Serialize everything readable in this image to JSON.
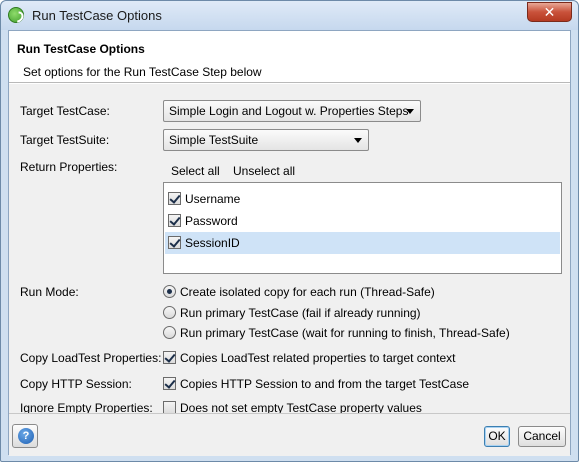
{
  "window": {
    "title": "Run TestCase Options",
    "close_glyph": "✕",
    "app_icon": "soapui-icon"
  },
  "header": {
    "title": "Run TestCase Options",
    "subtitle": "Set options for the Run TestCase Step below"
  },
  "form": {
    "target_testcase": {
      "label": "Target TestCase:",
      "value": "Simple Login and Logout w. Properties Steps"
    },
    "target_testsuite": {
      "label": "Target TestSuite:",
      "value": "Simple TestSuite"
    },
    "return_properties": {
      "label": "Return Properties:",
      "select_all": "Select all",
      "unselect_all": "Unselect all",
      "items": [
        {
          "label": "Username",
          "checked": true,
          "selected": false
        },
        {
          "label": "Password",
          "checked": true,
          "selected": false
        },
        {
          "label": "SessionID",
          "checked": true,
          "selected": true
        }
      ]
    },
    "run_mode": {
      "label": "Run Mode:",
      "options": [
        {
          "label": "Create isolated copy for each run (Thread-Safe)",
          "checked": true
        },
        {
          "label": "Run primary TestCase (fail if already running)",
          "checked": false
        },
        {
          "label": "Run primary TestCase (wait for running to finish, Thread-Safe)",
          "checked": false
        }
      ]
    },
    "copy_loadtest": {
      "label": "Copy LoadTest Properties:",
      "text": "Copies LoadTest related properties to target context",
      "checked": true
    },
    "copy_http": {
      "label": "Copy HTTP Session:",
      "text": "Copies HTTP Session to and from the target TestCase",
      "checked": true
    },
    "ignore_empty": {
      "label": "Ignore Empty Properties:",
      "text": "Does not set empty TestCase property values",
      "checked": false
    }
  },
  "footer": {
    "help_glyph": "?",
    "ok": "OK",
    "cancel": "Cancel"
  }
}
